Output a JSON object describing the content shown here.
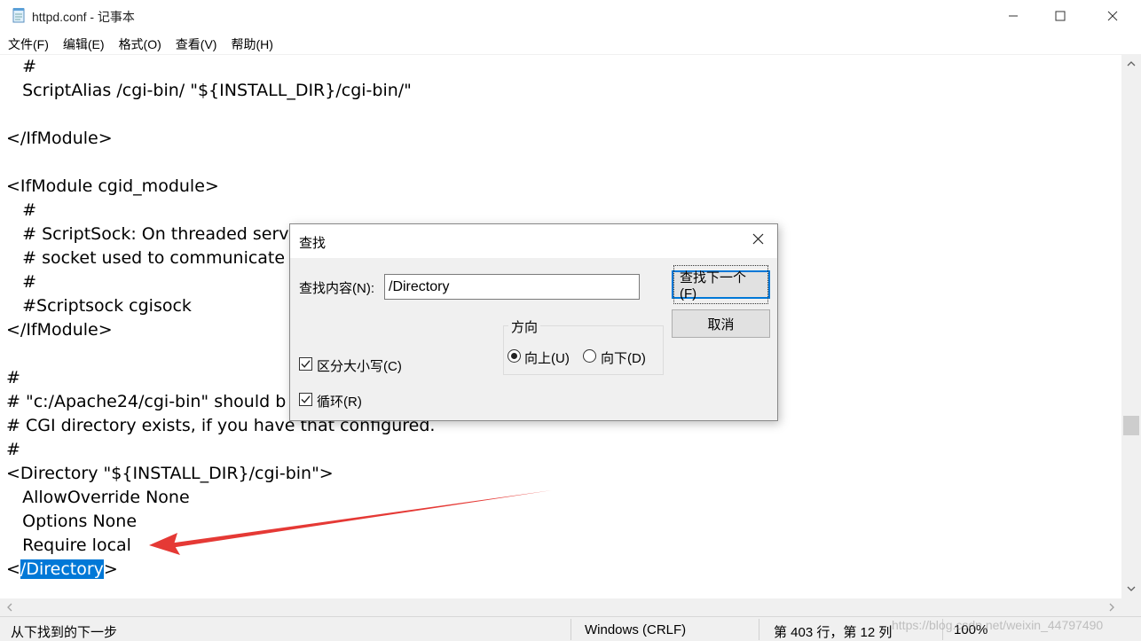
{
  "window": {
    "title": "httpd.conf - 记事本",
    "icon": "notepad-icon",
    "minimize_icon": "minimize-icon",
    "maximize_icon": "maximize-icon",
    "close_icon": "close-icon"
  },
  "menu": {
    "items": [
      {
        "label": "文件(F)"
      },
      {
        "label": "编辑(E)"
      },
      {
        "label": "格式(O)"
      },
      {
        "label": "查看(V)"
      },
      {
        "label": "帮助(H)"
      }
    ]
  },
  "editor": {
    "lines": [
      "   #",
      "   ScriptAlias /cgi-bin/ \"${INSTALL_DIR}/cgi-bin/\"",
      "",
      "</IfModule>",
      "",
      "<IfModule cgid_module>",
      "   #",
      "   # ScriptSock: On threaded serv",
      "   # socket used to communicate",
      "   #",
      "   #Scriptsock cgisock",
      "</IfModule>",
      "",
      "#",
      "# \"c:/Apache24/cgi-bin\" should b",
      "# CGI directory exists, if you have that configured.",
      "#",
      "<Directory \"${INSTALL_DIR}/cgi-bin\">",
      "   AllowOverride None",
      "   Options None",
      "   Require local"
    ],
    "last_line": {
      "before": "<",
      "selected": "/Directory",
      "after": ">"
    },
    "annotation_color": "#e53935"
  },
  "statusbar": {
    "message": "从下找到的下一步",
    "encoding": "Windows (CRLF)",
    "position": "第 403 行，第 12 列",
    "zoom": "100%",
    "watermark": "https://blog.csdn.net/weixin_44797490"
  },
  "find_dialog": {
    "title": "查找",
    "find_label": "查找内容(N):",
    "find_value": "/Directory",
    "find_next_label": "查找下一个(F)",
    "cancel_label": "取消",
    "direction_label": "方向",
    "up_label": "向上(U)",
    "down_label": "向下(D)",
    "direction_selected": "up",
    "match_case_label": "区分大小写(C)",
    "match_case_checked": true,
    "wrap_label": "循环(R)",
    "wrap_checked": true
  }
}
